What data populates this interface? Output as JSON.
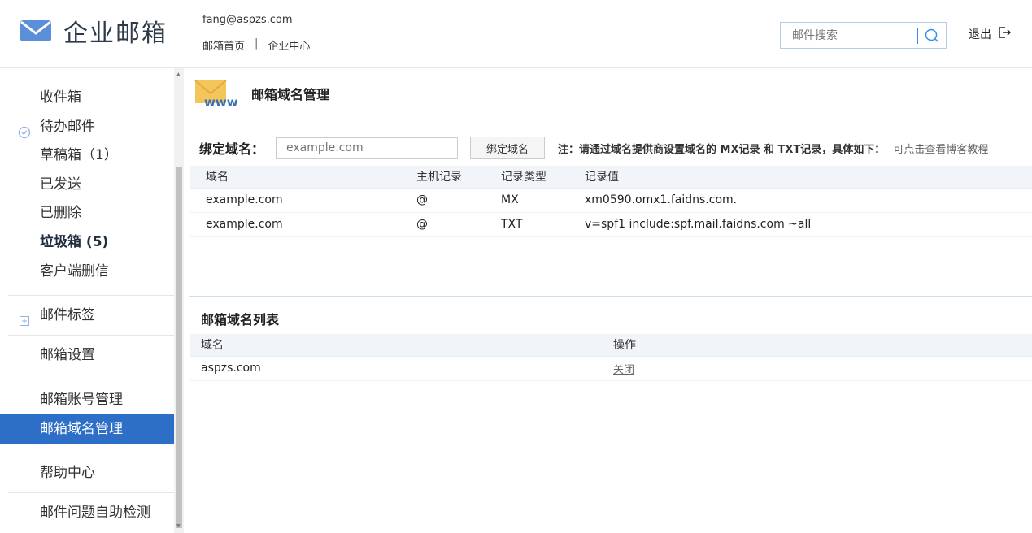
{
  "brand": {
    "name": "企业邮箱",
    "accent": "#2d6fc6",
    "logo_icon": "envelope-icon"
  },
  "account": {
    "email": "fang@aspzs.com",
    "links": [
      "邮箱首页",
      "企业中心"
    ],
    "separator": "|"
  },
  "search": {
    "placeholder": "邮件搜索",
    "icon": "search-icon"
  },
  "logout": {
    "label": "退出",
    "icon": "logout-icon"
  },
  "sidebar": {
    "items": [
      {
        "label": "收件箱"
      },
      {
        "label": "待办邮件",
        "icon": "check-circle-icon"
      },
      {
        "label": "草稿箱（1）"
      },
      {
        "label": "已发送"
      },
      {
        "label": "已删除"
      },
      {
        "label": "垃圾箱 (5)",
        "bold": true
      },
      {
        "label": "客户端删信"
      },
      {
        "label": "邮件标签",
        "icon": "plus-box-icon"
      },
      {
        "label": "邮箱设置"
      },
      {
        "label": "邮箱账号管理"
      },
      {
        "label": "邮箱域名管理",
        "active": true
      },
      {
        "label": "帮助中心"
      },
      {
        "label": "邮件问题自助检测"
      }
    ]
  },
  "main": {
    "title": "邮箱域名管理",
    "title_icon": "www-mail-icon",
    "icon_text": "www",
    "bind": {
      "label": "绑定域名：",
      "input_placeholder": "example.com",
      "button": "绑定域名",
      "note": "注：请通过域名提供商设置域名的 MX记录 和 TXT记录，具体如下：",
      "tutorial_link": "可点击查看博客教程"
    },
    "records": {
      "headers": [
        "域名",
        "主机记录",
        "记录类型",
        "记录值"
      ],
      "rows": [
        [
          "example.com",
          "@",
          "MX",
          "xm0590.omx1.faidns.com."
        ],
        [
          "example.com",
          "@",
          "TXT",
          "v=spf1 include:spf.mail.faidns.com ~all"
        ]
      ]
    },
    "domain_list": {
      "title": "邮箱域名列表",
      "headers": [
        "域名",
        "操作"
      ],
      "rows": [
        {
          "domain": "aspzs.com",
          "action": "关闭"
        }
      ]
    }
  }
}
